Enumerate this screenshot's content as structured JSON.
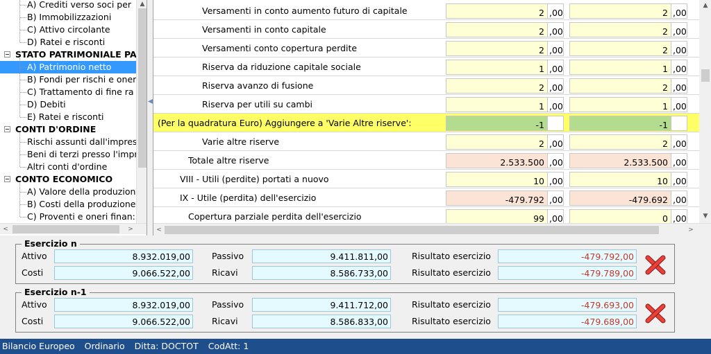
{
  "tree": {
    "items": [
      {
        "label": "A) Crediti verso soci per",
        "level": "child",
        "selected": false
      },
      {
        "label": "B) Immobilizzazioni",
        "level": "child",
        "selected": false
      },
      {
        "label": "C) Attivo circolante",
        "level": "child",
        "selected": false
      },
      {
        "label": "D) Ratei e risconti",
        "level": "child",
        "selected": false
      },
      {
        "label": "STATO PATRIMONIALE PA",
        "level": "group",
        "selected": false
      },
      {
        "label": "A) Patrimonio netto",
        "level": "child",
        "selected": true
      },
      {
        "label": "B) Fondi per rischi e oner",
        "level": "child",
        "selected": false
      },
      {
        "label": "C) Trattamento di fine ra",
        "level": "child",
        "selected": false
      },
      {
        "label": "D) Debiti",
        "level": "child",
        "selected": false
      },
      {
        "label": "E) Ratei e risconti",
        "level": "child",
        "selected": false
      },
      {
        "label": "CONTI D'ORDINE",
        "level": "group",
        "selected": false
      },
      {
        "label": "Rischi assunti dall'impres",
        "level": "child",
        "selected": false
      },
      {
        "label": "Beni di terzi presso l'impr",
        "level": "child",
        "selected": false
      },
      {
        "label": "Altri conti d'ordine",
        "level": "child",
        "selected": false
      },
      {
        "label": "CONTO ECONOMICO",
        "level": "group",
        "selected": false
      },
      {
        "label": "A) Valore della produzion",
        "level": "child",
        "selected": false
      },
      {
        "label": "B) Costi della produzione",
        "level": "child",
        "selected": false
      },
      {
        "label": "C) Proventi e oneri finan:",
        "level": "child",
        "selected": false
      }
    ]
  },
  "grid": {
    "rows": [
      {
        "label": "Versamenti in conto aumento futuro di capitale",
        "indent": 3,
        "v1": "2",
        "d1": ",00",
        "v2": "2",
        "d2": ",00",
        "style": "yellow"
      },
      {
        "label": "Versamenti in conto capitale",
        "indent": 3,
        "v1": "2",
        "d1": ",00",
        "v2": "2",
        "d2": ",00",
        "style": "yellow"
      },
      {
        "label": "Versamenti conto copertura perdite",
        "indent": 3,
        "v1": "2",
        "d1": ",00",
        "v2": "2",
        "d2": ",00",
        "style": "yellow"
      },
      {
        "label": "Riserva da riduzione capitale sociale",
        "indent": 3,
        "v1": "1",
        "d1": ",00",
        "v2": "1",
        "d2": ",00",
        "style": "yellow"
      },
      {
        "label": "Riserva avanzo di fusione",
        "indent": 3,
        "v1": "2",
        "d1": ",00",
        "v2": "2",
        "d2": ",00",
        "style": "yellow"
      },
      {
        "label": "Riserva per utili su cambi",
        "indent": 3,
        "v1": "1",
        "d1": ",00",
        "v2": "1",
        "d2": ",00",
        "style": "yellow"
      },
      {
        "label": "(Per la quadratura Euro) Aggiungere a 'Varie Altre riserve':",
        "indent": 0,
        "v1": "-1",
        "d1": "",
        "v2": "-1",
        "d2": "",
        "style": "green"
      },
      {
        "label": "Varie altre riserve",
        "indent": 3,
        "v1": "2",
        "d1": ",00",
        "v2": "2",
        "d2": ",00",
        "style": "yellow"
      },
      {
        "label": "Totale altre riserve",
        "indent": 2,
        "v1": "2.533.500",
        "d1": ",00",
        "v2": "2.533.500",
        "d2": ",00",
        "style": "pink"
      },
      {
        "label": "VIII - Utili (perdite) portati a nuovo",
        "indent": 1,
        "v1": "10",
        "d1": ",00",
        "v2": "10",
        "d2": ",00",
        "style": "yellow"
      },
      {
        "label": "IX - Utile (perdita) dell'esercizio",
        "indent": 1,
        "v1": "-479.792",
        "d1": ",00",
        "v2": "-479.692",
        "d2": ",00",
        "style": "pink"
      },
      {
        "label": "Copertura parziale perdita dell'esercizio",
        "indent": 2,
        "v1": "99",
        "d1": ",00",
        "v2": "0",
        "d2": ",00",
        "style": "yellow"
      }
    ]
  },
  "summary": [
    {
      "title": "Esercizio n",
      "attivo_label": "Attivo",
      "attivo": "8.932.019,00",
      "passivo_label": "Passivo",
      "passivo": "9.411.811,00",
      "ris1_label": "Risultato esercizio",
      "ris1": "-479.792,00",
      "costi_label": "Costi",
      "costi": "9.066.522,00",
      "ricavi_label": "Ricavi",
      "ricavi": "8.586.733,00",
      "ris2_label": "Risultato esercizio",
      "ris2": "-479.789,00",
      "icon": "red-x-icon"
    },
    {
      "title": "Esercizio n-1",
      "attivo_label": "Attivo",
      "attivo": "8.932.019,00",
      "passivo_label": "Passivo",
      "passivo": "9.411.712,00",
      "ris1_label": "Risultato esercizio",
      "ris1": "-479.693,00",
      "costi_label": "Costi",
      "costi": "9.066.522,00",
      "ricavi_label": "Ricavi",
      "ricavi": "8.586.833,00",
      "ris2_label": "Risultato esercizio",
      "ris2": "-479.689,00",
      "icon": "red-x-icon"
    }
  ],
  "status": {
    "items": [
      "Bilancio Europeo",
      "Ordinario",
      "Ditta: DOCTOT",
      "CodAtt: 1"
    ]
  },
  "colors": {
    "status_bar": "#1f4e8c",
    "selected": "#3399ff",
    "input_yellow": "#ffffd6",
    "input_pink": "#fbe4d5",
    "input_green": "#b3dc8e",
    "highlight_row": "#ffff66",
    "negative_text": "#c0392b"
  }
}
